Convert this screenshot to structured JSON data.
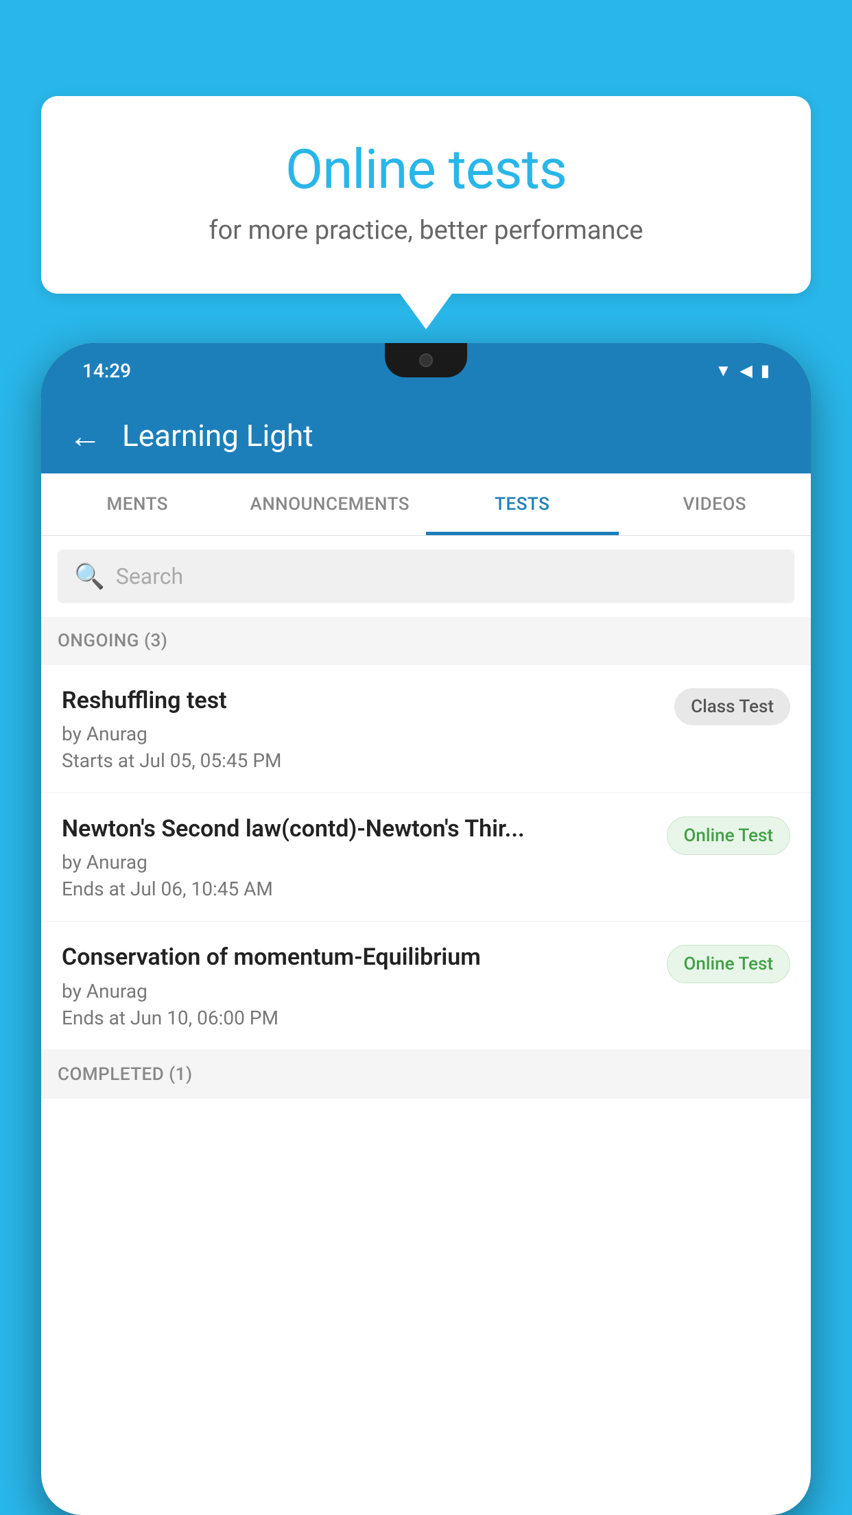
{
  "background_color": "#29B6E8",
  "speech_bubble": {
    "title": "Online tests",
    "subtitle": "for more practice, better performance"
  },
  "phone": {
    "status_bar": {
      "time": "14:29"
    },
    "app_bar": {
      "title": "Learning Light",
      "back_label": "←"
    },
    "tabs": [
      {
        "label": "MENTS",
        "active": false
      },
      {
        "label": "ANNOUNCEMENTS",
        "active": false
      },
      {
        "label": "TESTS",
        "active": true
      },
      {
        "label": "VIDEOS",
        "active": false
      }
    ],
    "search": {
      "placeholder": "Search"
    },
    "ongoing_section": {
      "label": "ONGOING (3)"
    },
    "tests": [
      {
        "title": "Reshuffling test",
        "author": "by Anurag",
        "date": "Starts at  Jul 05, 05:45 PM",
        "badge": "Class Test",
        "badge_type": "class"
      },
      {
        "title": "Newton's Second law(contd)-Newton's Thir...",
        "author": "by Anurag",
        "date": "Ends at  Jul 06, 10:45 AM",
        "badge": "Online Test",
        "badge_type": "online"
      },
      {
        "title": "Conservation of momentum-Equilibrium",
        "author": "by Anurag",
        "date": "Ends at  Jun 10, 06:00 PM",
        "badge": "Online Test",
        "badge_type": "online"
      }
    ],
    "completed_section": {
      "label": "COMPLETED (1)"
    }
  }
}
